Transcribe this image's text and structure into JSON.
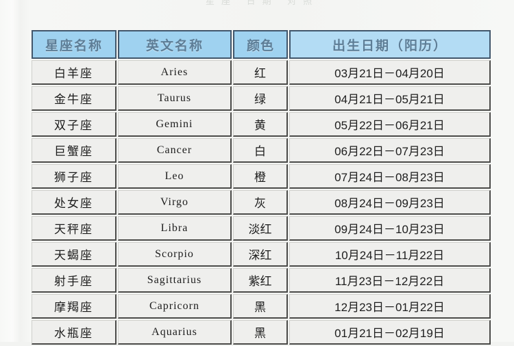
{
  "page": {
    "top_faint_text": "星座 日期 对照"
  },
  "table": {
    "columns": [
      {
        "key": "name",
        "label": "星座名称"
      },
      {
        "key": "en",
        "label": "英文名称"
      },
      {
        "key": "color",
        "label": "颜色"
      },
      {
        "key": "date",
        "label": "出生日期（阳历）"
      }
    ],
    "rows": [
      {
        "name": "白羊座",
        "en": "Aries",
        "color": "红",
        "date": "03月21日－04月20日"
      },
      {
        "name": "金牛座",
        "en": "Taurus",
        "color": "绿",
        "date": "04月21日－05月21日"
      },
      {
        "name": "双子座",
        "en": "Gemini",
        "color": "黄",
        "date": "05月22日－06月21日"
      },
      {
        "name": "巨蟹座",
        "en": "Cancer",
        "color": "白",
        "date": "06月22日－07月23日"
      },
      {
        "name": "狮子座",
        "en": "Leo",
        "color": "橙",
        "date": "07月24日－08月23日"
      },
      {
        "name": "处女座",
        "en": "Virgo",
        "color": "灰",
        "date": "08月24日－09月23日"
      },
      {
        "name": "天秤座",
        "en": "Libra",
        "color": "淡红",
        "date": "09月24日－10月23日"
      },
      {
        "name": "天蝎座",
        "en": "Scorpio",
        "color": "深红",
        "date": "10月24日－11月22日"
      },
      {
        "name": "射手座",
        "en": "Sagittarius",
        "color": "紫红",
        "date": "11月23日－12月22日"
      },
      {
        "name": "摩羯座",
        "en": "Capricorn",
        "color": "黑",
        "date": "12月23日－01月22日"
      },
      {
        "name": "水瓶座",
        "en": "Aquarius",
        "color": "黑",
        "date": "01月21日－02月19日"
      }
    ]
  },
  "colors": {
    "header_fill": "#9fd2f0",
    "header_fill_wide": "#b3dcf4",
    "header_border": "#41566b",
    "header_text": "#5d7d96",
    "cell_fill": "#efefed",
    "cell_border_dark": "#4a4a48",
    "page_background": "#f2f3f1"
  }
}
